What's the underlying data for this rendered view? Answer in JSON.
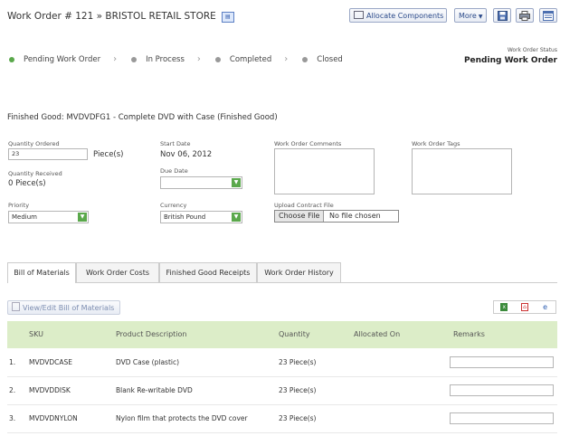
{
  "header": {
    "title": "Work Order # 121 » BRISTOL RETAIL STORE",
    "biz_icon": "business-card-icon",
    "allocate_label": "Allocate Components",
    "more_label": "More"
  },
  "status": {
    "steps": [
      "Pending Work Order",
      "In Process",
      "Completed",
      "Closed"
    ],
    "label": "Work Order Status",
    "value": "Pending Work Order"
  },
  "finished_good": "Finished Good: MVDVDFG1 - Complete DVD with Case (Finished Good)",
  "form": {
    "qty_ordered_label": "Quantity Ordered",
    "qty_ordered_value": "23",
    "qty_unit": "Piece(s)",
    "qty_received_label": "Quantity Received",
    "qty_received_value": "0 Piece(s)",
    "start_date_label": "Start Date",
    "start_date_value": "Nov 06, 2012",
    "due_date_label": "Due Date",
    "due_date_value": "",
    "priority_label": "Priority",
    "priority_value": "Medium",
    "currency_label": "Currency",
    "currency_value": "British Pound",
    "comments_label": "Work Order Comments",
    "tags_label": "Work Order Tags",
    "upload_label": "Upload Contract File",
    "choose_file_label": "Choose File",
    "no_file_label": "No file chosen"
  },
  "tabs": [
    "Bill of Materials",
    "Work Order Costs",
    "Finished Good Receipts",
    "Work Order History"
  ],
  "bom": {
    "edit_label": "View/Edit Bill of Materials",
    "columns": [
      "SKU",
      "Product Description",
      "Quantity",
      "Allocated On",
      "Remarks"
    ],
    "rows": [
      {
        "num": "1.",
        "sku": "MVDVDCASE",
        "desc": "DVD Case (plastic)",
        "qty": "23  Piece(s)"
      },
      {
        "num": "2.",
        "sku": "MVDVDDISK",
        "desc": "Blank Re-writable DVD",
        "qty": "23  Piece(s)"
      },
      {
        "num": "3.",
        "sku": "MVDVDNYLON",
        "desc": "Nylon film that protects the DVD cover",
        "qty": "23  Piece(s)"
      }
    ]
  },
  "colors": {
    "accent_green": "#5aa84b",
    "table_header": "#dcedc8",
    "link_blue": "#2b4a8a"
  }
}
